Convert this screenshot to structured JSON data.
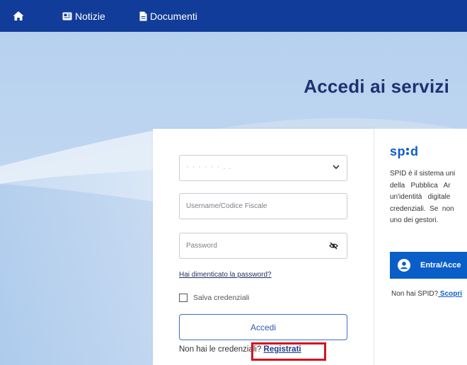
{
  "nav": {
    "home_icon": "home-icon",
    "news_icon": "newspaper-icon",
    "news_label": "Notizie",
    "docs_icon": "document-icon",
    "docs_label": "Documenti"
  },
  "hero": {
    "title": "Accedi ai servizi"
  },
  "login": {
    "select_value": "· · · · ·  · . .",
    "username_placeholder": "Username/Codice Fiscale",
    "password_placeholder": "Password",
    "forgot_label": "Hai dimenticato la password?",
    "remember_label": "Salva credenziali",
    "submit_label": "Accedi",
    "no_credentials_text": "Non hai le credenziali? ",
    "register_label": "Registrati"
  },
  "spid": {
    "logo": "spid",
    "description_lines": [
      "SPID è il sistema uni",
      "della   Pubblica   Ar",
      "un'identità   digitale",
      "credenziali.  Se  non",
      "uno dei gestori."
    ],
    "button_label": "Entra/Acce",
    "no_spid_text": "Non hai SPID?",
    "discover_label": " Scopri"
  },
  "colors": {
    "nav_bg": "#123c9a",
    "title": "#1d3270",
    "spid_blue": "#0a5ec8",
    "highlight": "#d5121c"
  }
}
